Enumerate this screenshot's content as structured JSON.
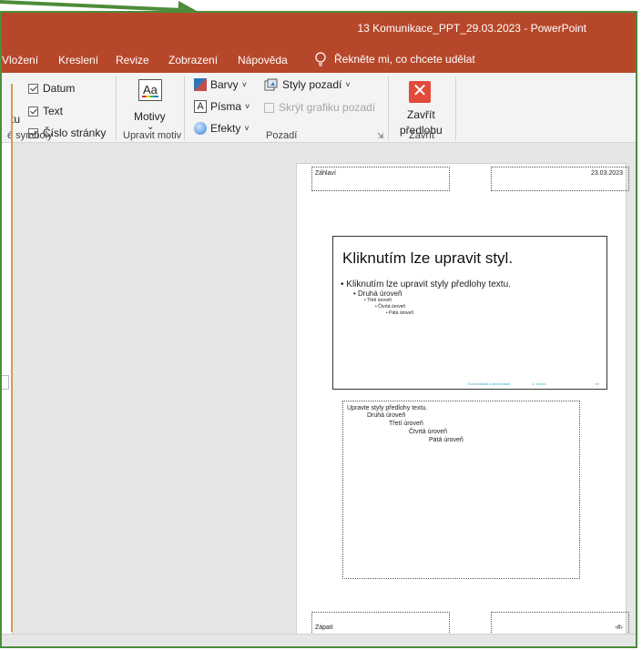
{
  "window": {
    "title": "13 Komunikace_PPT_29.03.2023  -  PowerPoint"
  },
  "tabs": [
    "Vložení",
    "Kreslení",
    "Revize",
    "Zobrazení",
    "Nápověda"
  ],
  "tell_me": "Řekněte mi, co chcete udělat",
  "ribbon": {
    "placeholders": {
      "partial_left": "tu",
      "checks": [
        {
          "label": "Datum",
          "checked": true
        },
        {
          "label": "Text",
          "checked": true
        },
        {
          "label": "Číslo stránky",
          "checked": true
        }
      ],
      "group_label": "é symboly"
    },
    "theme": {
      "button": "Motivy",
      "icon_text": "Aa",
      "chevron": "⌄",
      "group_label": "Upravit motiv"
    },
    "background": {
      "colors": "Barvy",
      "fonts": "Písma",
      "effects": "Efekty",
      "bg_styles": "Styly pozadí",
      "hide_graphics": "Skrýt grafiku pozadí",
      "dropdown": "˅",
      "group_label": "Pozadí",
      "launcher": "⇲",
      "fonts_icon_text": "A"
    },
    "close": {
      "button_line1": "Zavřít",
      "button_line2": "předlohu",
      "icon_text": "✕",
      "group_label": "Zavřít"
    }
  },
  "handout": {
    "header": "Záhlaví",
    "date": "23.03.2023",
    "footer": "Zápatí",
    "page_number": "‹#›",
    "slide": {
      "title": "Kliknutím lze upravit styl.",
      "bullets": [
        "• Kliknutím lze upravit styly předlohy textu.",
        "• Druhá úroveň",
        "• Třetí úroveň",
        "• Čtvrtá úroveň",
        "• Pátá úroveň"
      ],
      "footer_left": "Komunikace a prezentace",
      "footer_mid": "1. ročník",
      "footer_right": "‹#›"
    },
    "notes": [
      "Upravte styly předlohy textu.",
      "Druhá úroveň",
      "Třetí úroveň",
      "Čtvrtá úroveň",
      "Pátá úroveň"
    ]
  },
  "colors": {
    "accent": "#b7472a",
    "frame": "#4c8c3a",
    "close_icon": "#e04b3b"
  }
}
